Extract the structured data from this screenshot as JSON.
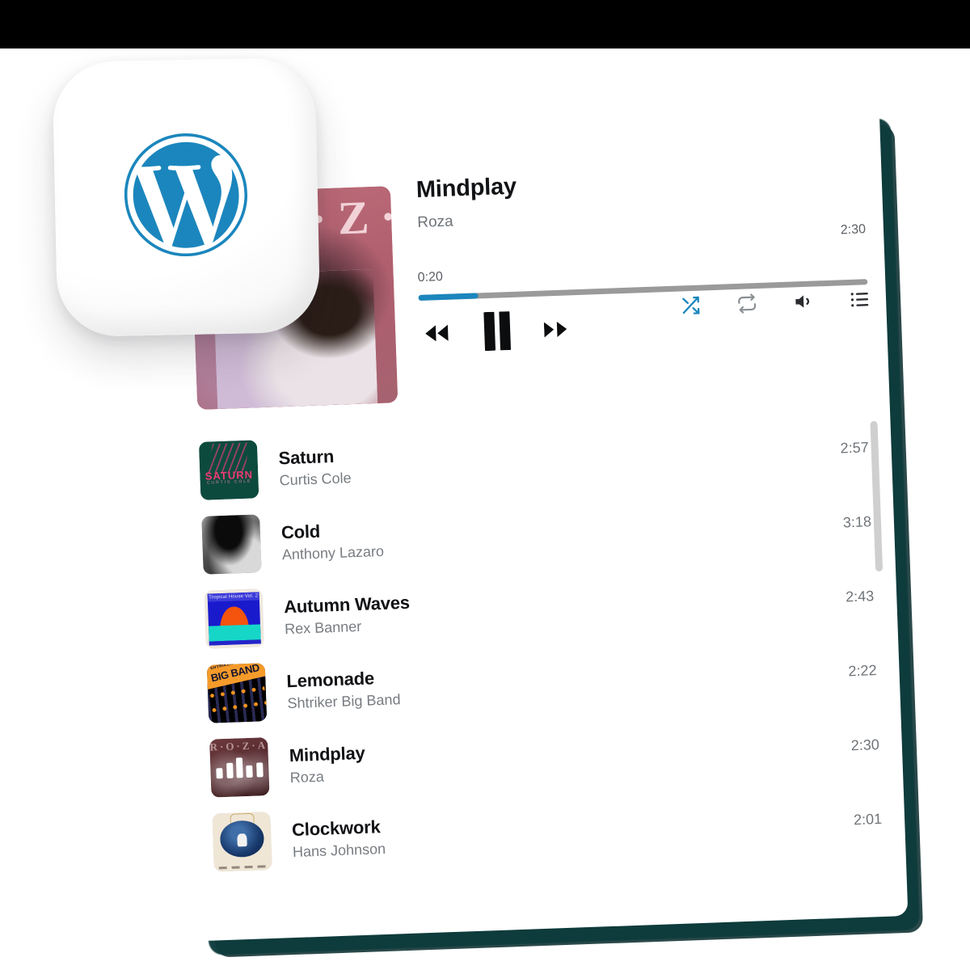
{
  "brand": {
    "logo_name": "wordpress-logo",
    "accent_color": "#1b86bd"
  },
  "now_playing": {
    "title": "Mindplay",
    "artist": "Roza",
    "current_time": "0:20",
    "duration": "2:30",
    "progress_percent": 13.3,
    "album_art": {
      "name": "roza-mindplay-cover",
      "letters": "R·O·Z·A"
    },
    "controls": {
      "previous": "rewind-button",
      "play_pause": "pause-button",
      "next": "fast-forward-button",
      "shuffle": "shuffle-button",
      "repeat": "repeat-button",
      "volume": "volume-button",
      "playlist": "playlist-button"
    },
    "shuffle_active": true
  },
  "playlist": {
    "tracks": [
      {
        "title": "Saturn",
        "artist": "Curtis Cole",
        "duration": "2:57",
        "art": "saturn",
        "art_text": "SATURN",
        "art_sub": "CURTIS COLE"
      },
      {
        "title": "Cold",
        "artist": "Anthony Lazaro",
        "duration": "3:18",
        "art": "cold",
        "art_text": "",
        "art_sub": ""
      },
      {
        "title": "Autumn Waves",
        "artist": "Rex Banner",
        "duration": "2:43",
        "art": "autumn",
        "art_text": "Tropical House Vol. 2",
        "art_sub": ""
      },
      {
        "title": "Lemonade",
        "artist": "Shtriker Big Band",
        "duration": "2:22",
        "art": "lemonade",
        "art_text": "BIG BAND",
        "art_sub": "SHTRIKER"
      },
      {
        "title": "Mindplay",
        "artist": "Roza",
        "duration": "2:30",
        "art": "mindplay",
        "art_text": "R·O·Z·A",
        "art_sub": ""
      },
      {
        "title": "Clockwork",
        "artist": "Hans Johnson",
        "duration": "2:01",
        "art": "clock",
        "art_text": "",
        "art_sub": ""
      }
    ]
  },
  "scrollbar": {
    "name": "playlist-scrollbar"
  }
}
